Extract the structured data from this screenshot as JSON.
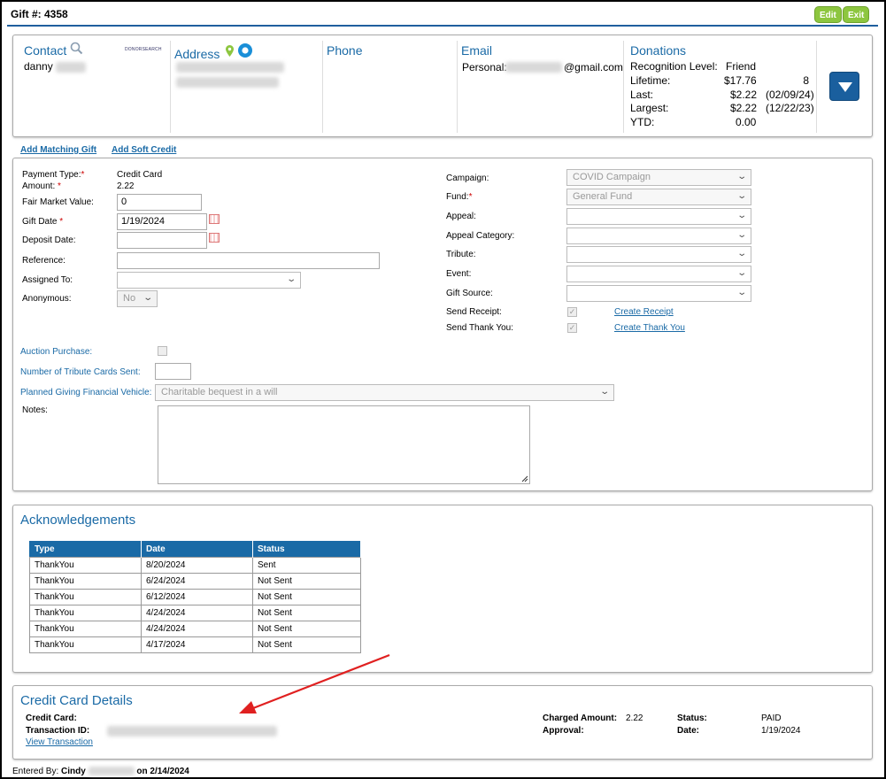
{
  "header": {
    "gift_title": "Gift #: 4358",
    "edit_label": "Edit",
    "exit_label": "Exit"
  },
  "contact": {
    "contact_title": "Contact",
    "contact_name": "danny",
    "donorsearch_logo": "DONORSEARCH",
    "address_title": "Address",
    "phone_title": "Phone",
    "email_title": "Email",
    "email_personal_label": "Personal:",
    "email_domain": "@gmail.com",
    "donations_title": "Donations",
    "recognition_label": "Recognition Level:",
    "recognition_value": "Friend",
    "lifetime_label": "Lifetime:",
    "lifetime_amount": "$17.76",
    "lifetime_count": "8",
    "last_label": "Last:",
    "last_amount": "$2.22",
    "last_date": "(02/09/24)",
    "largest_label": "Largest:",
    "largest_amount": "$2.22",
    "largest_date": "(12/22/23)",
    "ytd_label": "YTD:",
    "ytd_amount": "0.00"
  },
  "links": {
    "add_matching_gift": "Add Matching Gift",
    "add_soft_credit": "Add Soft Credit"
  },
  "gift_form": {
    "payment_type_label": "Payment Type:",
    "payment_type_value": "Credit Card",
    "amount_label": "Amount:",
    "amount_value": "2.22",
    "fair_market_label": "Fair Market Value:",
    "fair_market_value": "0",
    "gift_date_label": "Gift Date",
    "gift_date_value": "1/19/2024",
    "deposit_date_label": "Deposit Date:",
    "reference_label": "Reference:",
    "assigned_to_label": "Assigned To:",
    "anonymous_label": "Anonymous:",
    "anonymous_value": "No",
    "campaign_label": "Campaign:",
    "campaign_value": "COVID Campaign",
    "fund_label": "Fund:",
    "fund_value": "General Fund",
    "appeal_label": "Appeal:",
    "appeal_category_label": "Appeal Category:",
    "tribute_label": "Tribute:",
    "event_label": "Event:",
    "gift_source_label": "Gift Source:",
    "send_receipt_label": "Send Receipt:",
    "create_receipt_link": "Create Receipt",
    "send_thankyou_label": "Send Thank You:",
    "create_thankyou_link": "Create Thank You",
    "auction_label": "Auction Purchase:",
    "tribute_cards_label": "Number of Tribute Cards Sent:",
    "planned_giving_label": "Planned Giving Financial Vehicle:",
    "planned_giving_value": "Charitable bequest in a will",
    "notes_label": "Notes:"
  },
  "acknowledgements": {
    "title": "Acknowledgements",
    "columns": [
      "Type",
      "Date",
      "Status"
    ],
    "rows": [
      [
        "ThankYou",
        "8/20/2024",
        "Sent"
      ],
      [
        "ThankYou",
        "6/24/2024",
        "Not Sent"
      ],
      [
        "ThankYou",
        "6/12/2024",
        "Not Sent"
      ],
      [
        "ThankYou",
        "4/24/2024",
        "Not Sent"
      ],
      [
        "ThankYou",
        "4/24/2024",
        "Not Sent"
      ],
      [
        "ThankYou",
        "4/17/2024",
        "Not Sent"
      ]
    ]
  },
  "credit_card": {
    "title": "Credit Card Details",
    "credit_card_label": "Credit Card:",
    "transaction_id_label": "Transaction ID:",
    "view_transaction_link": "View Transaction",
    "charged_amount_label": "Charged Amount:",
    "charged_amount_value": "2.22",
    "approval_label": "Approval:",
    "status_label": "Status:",
    "status_value": "PAID",
    "date_label": "Date:",
    "date_value": "1/19/2024"
  },
  "footer": {
    "entered_by_label": "Entered By:",
    "entered_by_name": "Cindy",
    "entered_on": "on 2/14/2024"
  },
  "colors": {
    "accent_blue": "#1a6aa6",
    "button_green": "#8dc63f",
    "required_red": "#cc0000",
    "annotation_arrow": "#e02020"
  },
  "icons": [
    "search-icon",
    "map-pin-icon",
    "location-circle-icon",
    "dropdown-arrow-icon",
    "calendar-icon",
    "chevron-down-icon",
    "resize-grip-icon"
  ]
}
